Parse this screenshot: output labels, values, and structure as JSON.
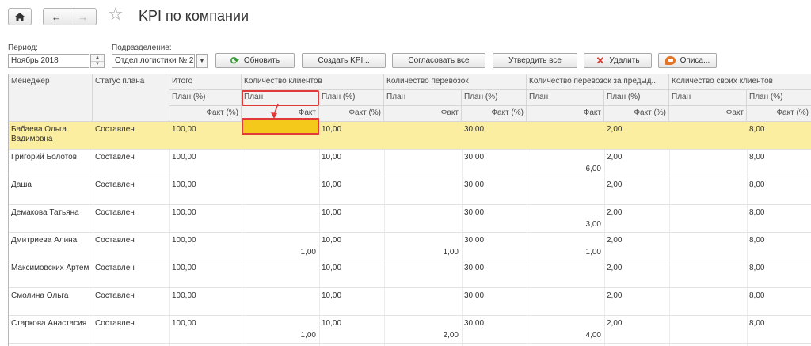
{
  "header": {
    "title": "KPI по компании",
    "back_arrow": "←",
    "forward_arrow": "→",
    "home_icon": "home-icon",
    "favorite_icon": "star-icon"
  },
  "filters": {
    "period_label": "Период:",
    "period_value": "Ноябрь 2018",
    "department_label": "Подразделение:",
    "department_value": "Отдел логистики № 2"
  },
  "toolbar": {
    "refresh": "Обновить",
    "create_kpi": "Создать KPI...",
    "approve_all": "Согласовать все",
    "confirm_all": "Утвердить все",
    "delete": "Удалить",
    "description": "Описа..."
  },
  "table": {
    "col_manager": "Менеджер",
    "col_status": "Статус плана",
    "col_total": "Итого",
    "plan_pct": "План (%)",
    "fact_pct": "Факт (%)",
    "plan": "План",
    "fact": "Факт",
    "groups": [
      "Количество клиентов",
      "Количество перевозок",
      "Количество перевозок за предыд...",
      "Количество своих клиентов"
    ],
    "rows": [
      {
        "name": "Бабаева Ольга Вадимовна",
        "status": "Составлен",
        "total": "100,00",
        "g1": "10,00",
        "g1f": "",
        "g2": "30,00",
        "g2f": "",
        "g3": "2,00",
        "g3f": "",
        "g4": "8,00"
      },
      {
        "name": "Григорий Болотов",
        "status": "Составлен",
        "total": "100,00",
        "g1": "10,00",
        "g1f": "",
        "g2": "30,00",
        "g2f": "",
        "g3": "2,00",
        "g3f": "6,00",
        "g4": "8,00"
      },
      {
        "name": "Даша",
        "status": "Составлен",
        "total": "100,00",
        "g1": "10,00",
        "g1f": "",
        "g2": "30,00",
        "g2f": "",
        "g3": "2,00",
        "g3f": "",
        "g4": "8,00"
      },
      {
        "name": "Демакова Татьяна",
        "status": "Составлен",
        "total": "100,00",
        "g1": "10,00",
        "g1f": "",
        "g2": "30,00",
        "g2f": "",
        "g3": "2,00",
        "g3f": "3,00",
        "g4": "8,00"
      },
      {
        "name": "Дмитриева Алина",
        "status": "Составлен",
        "total": "100,00",
        "g1": "10,00",
        "g1f": "1,00",
        "g2": "30,00",
        "g2f": "1,00",
        "g3": "2,00",
        "g3f": "1,00",
        "g4": "8,00"
      },
      {
        "name": "Максимовских Артем",
        "status": "Составлен",
        "total": "100,00",
        "g1": "10,00",
        "g1f": "",
        "g2": "30,00",
        "g2f": "",
        "g3": "2,00",
        "g3f": "",
        "g4": "8,00"
      },
      {
        "name": "Смолина Ольга",
        "status": "Составлен",
        "total": "100,00",
        "g1": "10,00",
        "g1f": "",
        "g2": "30,00",
        "g2f": "",
        "g3": "2,00",
        "g3f": "",
        "g4": "8,00"
      },
      {
        "name": "Старкова Анастасия",
        "status": "Составлен",
        "total": "100,00",
        "g1": "10,00",
        "g1f": "1,00",
        "g2": "30,00",
        "g2f": "2,00",
        "g3": "2,00",
        "g3f": "4,00",
        "g4": "8,00"
      }
    ]
  },
  "colors": {
    "selected_row": "#fbeea0",
    "highlight_fill": "#f5c81c",
    "annotation_red": "#e03a3a"
  }
}
